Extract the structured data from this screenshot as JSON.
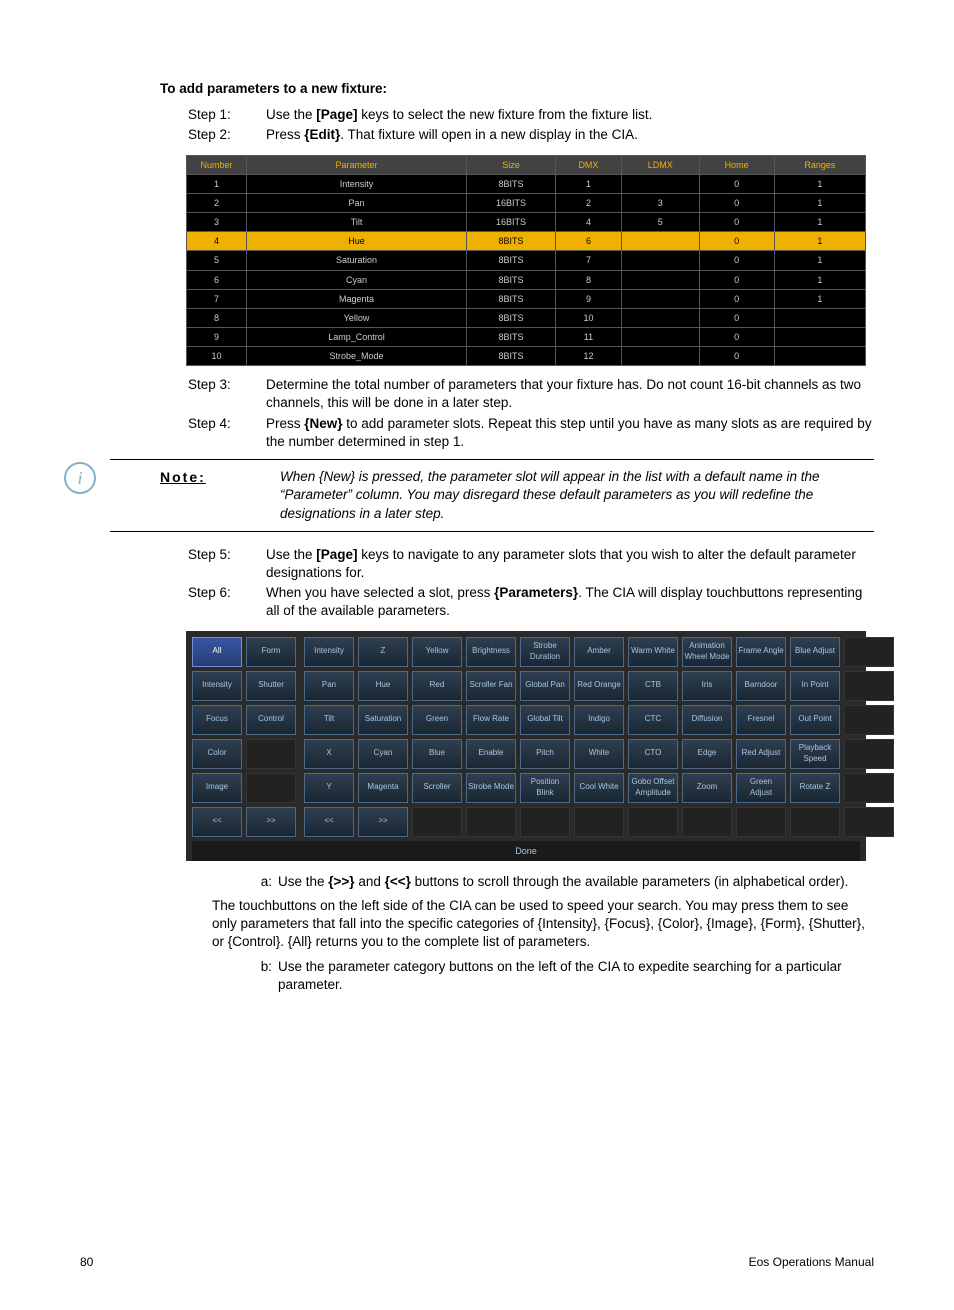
{
  "title": "To add parameters to a new fixture:",
  "stepsA": [
    {
      "label": "Step 1:",
      "html": "Use the <b>[Page]</b> keys to select the new fixture from the fixture list."
    },
    {
      "label": "Step 2:",
      "html": "Press <b>{Edit}</b>. That fixture will open in a new display in the CIA."
    }
  ],
  "paramHeaders": [
    "Number",
    "Parameter",
    "Size",
    "DMX",
    "LDMX",
    "Home",
    "Ranges"
  ],
  "paramRows": [
    {
      "n": "1",
      "p": "Intensity",
      "s": "8BITS",
      "d": "1",
      "l": "",
      "h": "0",
      "r": "1"
    },
    {
      "n": "2",
      "p": "Pan",
      "s": "16BITS",
      "d": "2",
      "l": "3",
      "h": "0",
      "r": "1"
    },
    {
      "n": "3",
      "p": "Tilt",
      "s": "16BITS",
      "d": "4",
      "l": "5",
      "h": "0",
      "r": "1"
    },
    {
      "n": "4",
      "p": "Hue",
      "s": "8BITS",
      "d": "6",
      "l": "",
      "h": "0",
      "r": "1",
      "hl": true
    },
    {
      "n": "5",
      "p": "Saturation",
      "s": "8BITS",
      "d": "7",
      "l": "",
      "h": "0",
      "r": "1"
    },
    {
      "n": "6",
      "p": "Cyan",
      "s": "8BITS",
      "d": "8",
      "l": "",
      "h": "0",
      "r": "1"
    },
    {
      "n": "7",
      "p": "Magenta",
      "s": "8BITS",
      "d": "9",
      "l": "",
      "h": "0",
      "r": "1"
    },
    {
      "n": "8",
      "p": "Yellow",
      "s": "8BITS",
      "d": "10",
      "l": "",
      "h": "0",
      "r": ""
    },
    {
      "n": "9",
      "p": "Lamp_Control",
      "s": "8BITS",
      "d": "11",
      "l": "",
      "h": "0",
      "r": ""
    },
    {
      "n": "10",
      "p": "Strobe_Mode",
      "s": "8BITS",
      "d": "12",
      "l": "",
      "h": "0",
      "r": ""
    }
  ],
  "stepsB": [
    {
      "label": "Step 3:",
      "html": "Determine the total number of parameters that your fixture has. Do not count 16-bit channels as two channels, this will be done in a later step."
    },
    {
      "label": "Step 4:",
      "html": "Press <b>{New}</b> to add parameter slots. Repeat this step until you have as many slots as are required by the number determined in step 1."
    }
  ],
  "note": {
    "label": "Note:",
    "text": "When {New} is pressed, the parameter slot will appear in the list with a default name in the “Parameter” column. You may disregard these default parameters as you will redefine the designations in a later step."
  },
  "stepsC": [
    {
      "label": "Step 5:",
      "html": "Use the <b>[Page]</b> keys to navigate to any parameter slots that you wish to alter the default parameter designations for."
    },
    {
      "label": "Step 6:",
      "html": "When you have selected a slot, press <b>{Parameters}</b>. The CIA will display touchbuttons representing all of the available parameters."
    }
  ],
  "catButtons": [
    [
      "All",
      "Form"
    ],
    [
      "Intensity",
      "Shutter"
    ],
    [
      "Focus",
      "Control"
    ],
    [
      "Color",
      ""
    ],
    [
      "Image",
      ""
    ],
    [
      "<<",
      ">>"
    ]
  ],
  "gridButtons": [
    [
      "Intensity",
      "Z",
      "Yellow",
      "Brightness",
      "Strobe Duration",
      "Amber",
      "Warm White",
      "Animation Wheel Mode",
      "Frame Angle",
      "Blue Adjust",
      ""
    ],
    [
      "Pan",
      "Hue",
      "Red",
      "Scroller Fan",
      "Global Pan",
      "Red Orange",
      "CTB",
      "Iris",
      "Barndoor",
      "In Point",
      ""
    ],
    [
      "Tilt",
      "Saturation",
      "Green",
      "Flow Rate",
      "Global Tilt",
      "Indigo",
      "CTC",
      "Diffusion",
      "Fresnel",
      "Out Point",
      ""
    ],
    [
      "X",
      "Cyan",
      "Blue",
      "Enable",
      "Pitch",
      "White",
      "CTO",
      "Edge",
      "Red Adjust",
      "Playback Speed",
      ""
    ],
    [
      "Y",
      "Magenta",
      "Scroller",
      "Strobe Mode",
      "Position Blink",
      "Cool White",
      "Gobo Offset Amplitude",
      "Zoom",
      "Green Adjust",
      "Rotate Z",
      ""
    ],
    [
      "<<",
      ">>",
      "",
      "",
      "",
      "",
      "",
      "",
      "",
      "",
      ""
    ]
  ],
  "doneLabel": "Done",
  "subA": {
    "label": "a:",
    "html": "Use the <b>{>>}</b> and <b>{<<}</b> buttons to scroll through the available parameters (in alphabetical order)."
  },
  "paraText": "The touchbuttons on the left side of the CIA can be used to speed your search. You may press them to see only parameters that fall into the specific categories of {Intensity}, {Focus}, {Color}, {Image}, {Form}, {Shutter}, or {Control}. {All} returns you to the complete list of parameters.",
  "subB": {
    "label": "b:",
    "text": "Use the parameter category buttons on the left of the CIA to expedite searching for a particular parameter."
  },
  "footer": {
    "page": "80",
    "title": "Eos Operations Manual"
  }
}
